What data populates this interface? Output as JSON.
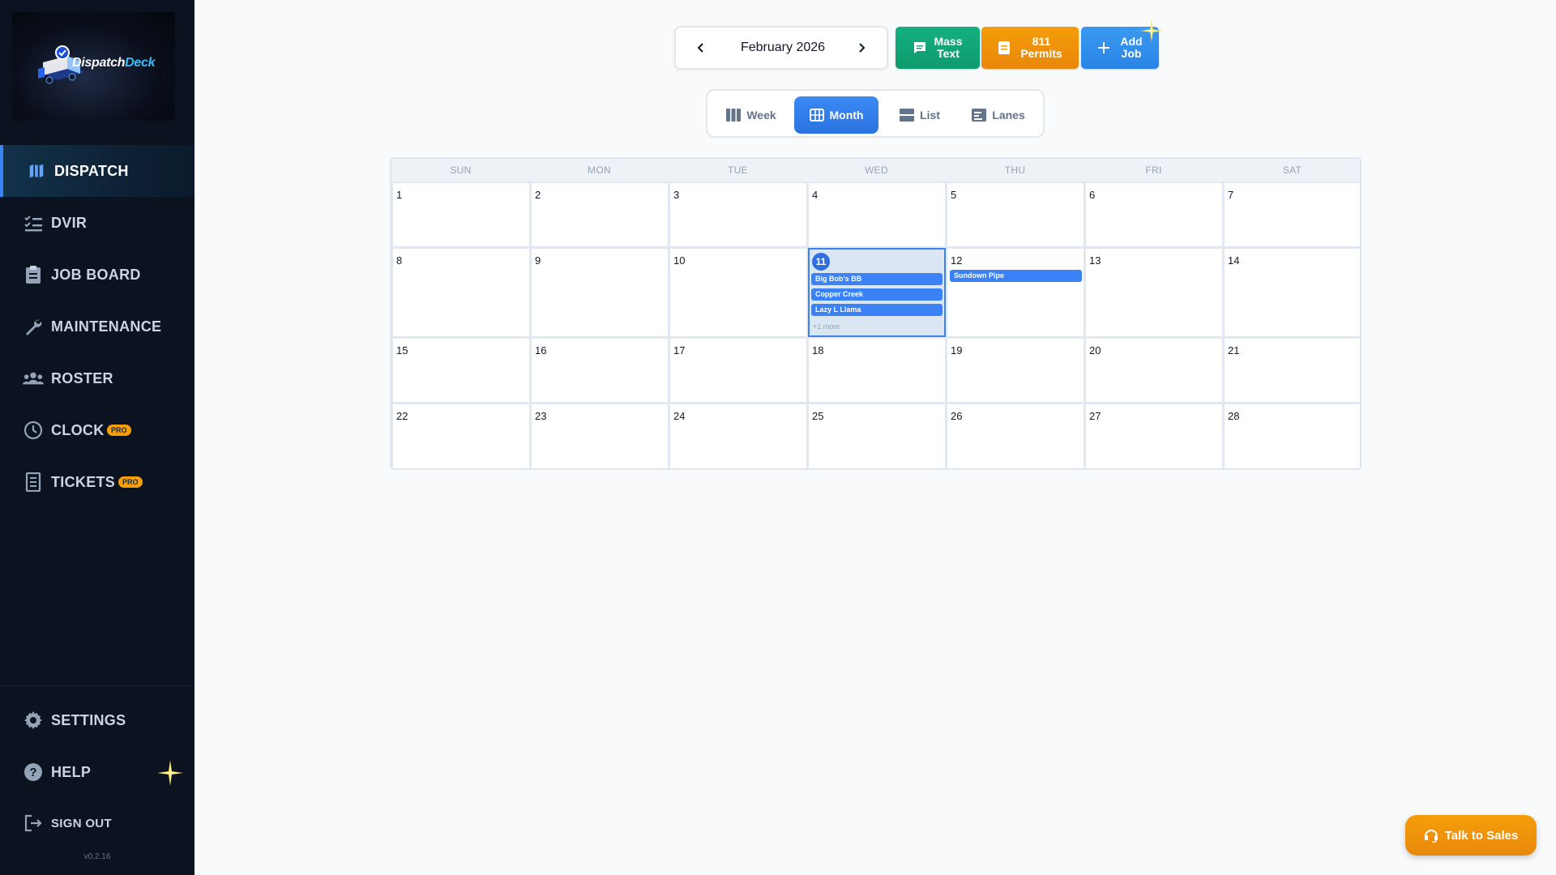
{
  "app": {
    "brand_main": "Dispatch",
    "brand_accent": "Deck",
    "version": "v0.2.16",
    "accent_color": "#3b82f6"
  },
  "sidebar": {
    "items": [
      {
        "label": "DISPATCH",
        "icon": "map-icon",
        "active": true
      },
      {
        "label": "DVIR",
        "icon": "checklist-icon"
      },
      {
        "label": "JOB BOARD",
        "icon": "clipboard-icon"
      },
      {
        "label": "MAINTENANCE",
        "icon": "wrench-icon"
      },
      {
        "label": "ROSTER",
        "icon": "people-icon"
      },
      {
        "label": "CLOCK",
        "icon": "clock-icon",
        "badge": "PRO"
      },
      {
        "label": "TICKETS",
        "icon": "receipt-icon",
        "badge": "PRO"
      }
    ],
    "bottom": [
      {
        "label": "SETTINGS",
        "icon": "gear-icon"
      },
      {
        "label": "HELP",
        "icon": "help-icon"
      },
      {
        "label": "SIGN OUT",
        "icon": "sign-out-icon"
      }
    ]
  },
  "toolbar": {
    "month_label": "February 2026",
    "mass_text_line1": "Mass",
    "mass_text_line2": "Text",
    "permits_line1": "811",
    "permits_line2": "Permits",
    "add_job_line1": "Add",
    "add_job_line2": "Job"
  },
  "views": [
    {
      "label": "Week",
      "icon": "columns-icon"
    },
    {
      "label": "Month",
      "icon": "grid-icon",
      "active": true
    },
    {
      "label": "List",
      "icon": "list-icon"
    },
    {
      "label": "Lanes",
      "icon": "lanes-icon"
    }
  ],
  "calendar": {
    "weekdays": [
      "SUN",
      "MON",
      "TUE",
      "WED",
      "THU",
      "FRI",
      "SAT"
    ],
    "weeks": [
      [
        "1",
        "2",
        "3",
        "4",
        "5",
        "6",
        "7"
      ],
      [
        "8",
        "9",
        "10",
        "11",
        "12",
        "13",
        "14"
      ],
      [
        "15",
        "16",
        "17",
        "18",
        "19",
        "20",
        "21"
      ],
      [
        "22",
        "23",
        "24",
        "25",
        "26",
        "27",
        "28"
      ]
    ],
    "today": "11",
    "events": {
      "11": [
        "Big Bob's BB",
        "Copper Creek",
        "Lazy L Llama"
      ],
      "12": [
        "Sundown Pipe"
      ]
    },
    "more_11": "+1 more"
  },
  "sales_button": "Talk to Sales"
}
